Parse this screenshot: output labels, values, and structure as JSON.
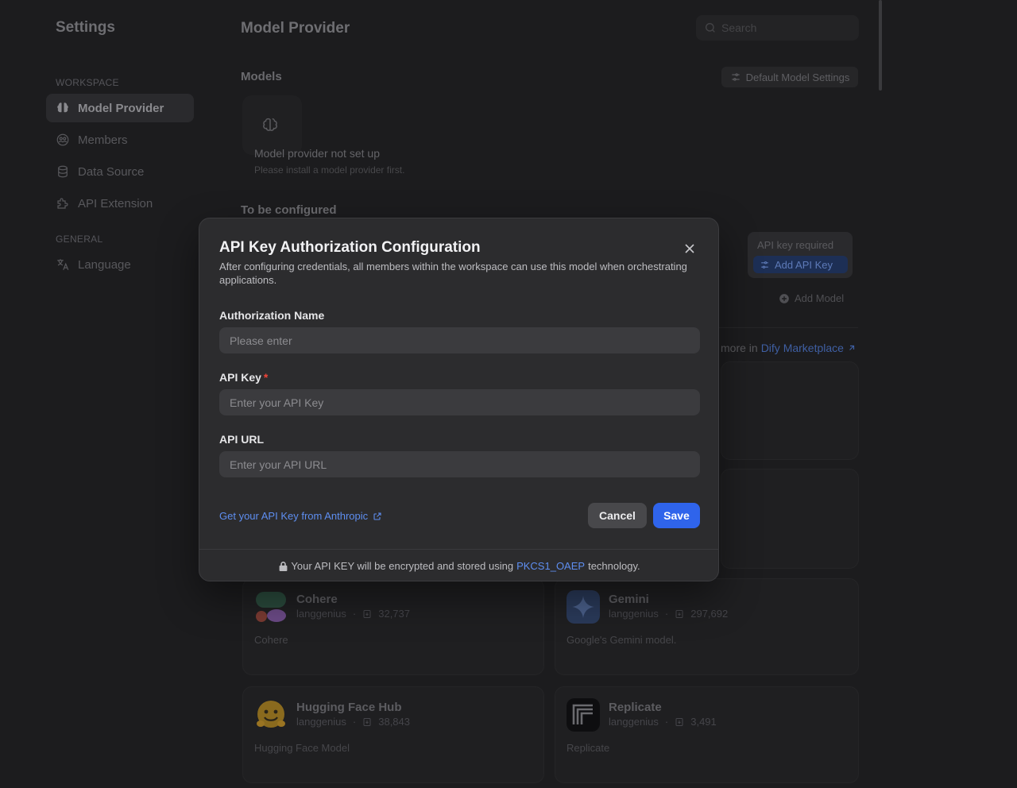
{
  "sidebar": {
    "title": "Settings",
    "workspace_label": "WORKSPACE",
    "general_label": "GENERAL",
    "items": [
      {
        "label": "Model Provider",
        "icon": "brain-icon",
        "active": true
      },
      {
        "label": "Members",
        "icon": "members-icon",
        "active": false
      },
      {
        "label": "Data Source",
        "icon": "database-icon",
        "active": false
      },
      {
        "label": "API Extension",
        "icon": "puzzle-icon",
        "active": false
      },
      {
        "label": "Language",
        "icon": "translate-icon",
        "active": false
      }
    ]
  },
  "header": {
    "title": "Model Provider",
    "search_placeholder": "Search"
  },
  "models": {
    "label": "Models",
    "default_settings_label": "Default Model Settings",
    "empty_title": "Model provider not set up",
    "empty_subtitle": "Please install a model provider first."
  },
  "to_be_configured": {
    "label": "To be configured",
    "api_key_required": "API key required",
    "add_api_key_label": "Add API Key",
    "add_model_label": "Add Model"
  },
  "marketplace": {
    "prefix": "more in",
    "link_label": "Dify Marketplace"
  },
  "providers": [
    {
      "name": "Cohere",
      "author": "langgenius",
      "installs": "32,737",
      "description": "Cohere"
    },
    {
      "name": "Gemini",
      "author": "langgenius",
      "installs": "297,692",
      "description": "Google's Gemini model."
    },
    {
      "name": "Hugging Face Hub",
      "author": "langgenius",
      "installs": "38,843",
      "description": "Hugging Face Model"
    },
    {
      "name": "Replicate",
      "author": "langgenius",
      "installs": "3,491",
      "description": "Replicate"
    }
  ],
  "modal": {
    "title": "API Key Authorization Configuration",
    "description": "After configuring credentials, all members within the workspace can use this model when orchestrating applications.",
    "fields": {
      "auth_name": {
        "label": "Authorization Name",
        "placeholder": "Please enter",
        "value": ""
      },
      "api_key": {
        "label": "API Key",
        "required_mark": "*",
        "placeholder": "Enter your API Key",
        "value": ""
      },
      "api_url": {
        "label": "API URL",
        "placeholder": "Enter your API URL",
        "value": ""
      }
    },
    "get_key_link": "Get your API Key from Anthropic",
    "cancel_label": "Cancel",
    "save_label": "Save",
    "footer_prefix": "Your API KEY will be encrypted and stored using",
    "footer_tech": "PKCS1_OAEP",
    "footer_suffix": "technology."
  },
  "colors": {
    "background": "#1c1c1e",
    "modal_bg": "#2c2c2e",
    "accent": "#2f64eb",
    "link": "#5e8ef0",
    "required": "#f04438"
  }
}
